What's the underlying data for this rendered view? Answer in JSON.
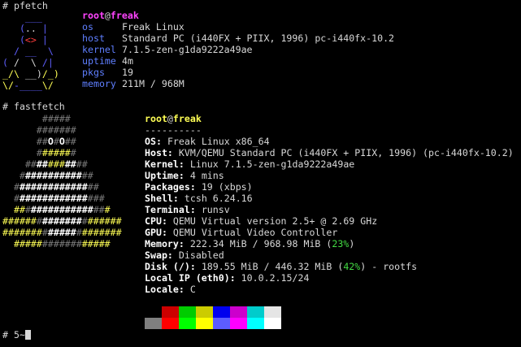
{
  "commands": {
    "pfetch": "# pfetch",
    "fastfetch": "# fastfetch",
    "prompt": "# 5~"
  },
  "pfetch": {
    "user": "root",
    "at": "@",
    "host": "freak",
    "rows": [
      {
        "key": "os",
        "value": "Freak Linux"
      },
      {
        "key": "host",
        "value": "Standard PC (i440FX + PIIX, 1996) pc-i440fx-10.2"
      },
      {
        "key": "kernel",
        "value": "7.1.5-zen-g1da9222a49ae"
      },
      {
        "key": "uptime",
        "value": "4m"
      },
      {
        "key": "pkgs",
        "value": "19"
      },
      {
        "key": "memory",
        "value": "211M / 968M"
      }
    ],
    "logo": [
      "    ___",
      "   (.. |",
      "   (<> |",
      "  / __  \\",
      " ( /  \\ /|",
      "_/\\ __)/_)",
      "\\/-____\\/"
    ]
  },
  "fastfetch": {
    "user": "root",
    "at": "@",
    "host": "freak",
    "separator": "----------",
    "rows": [
      {
        "key": "OS",
        "value": "Freak Linux x86_64"
      },
      {
        "key": "Host",
        "value": "KVM/QEMU Standard PC (i440FX + PIIX, 1996) (pc-i440fx-10.2)"
      },
      {
        "key": "Kernel",
        "value": "Linux 7.1.5-zen-g1da9222a49ae"
      },
      {
        "key": "Uptime",
        "value": "4 mins"
      },
      {
        "key": "Packages",
        "value": "19 (xbps)"
      },
      {
        "key": "Shell",
        "value": "tcsh 6.24.16"
      },
      {
        "key": "Terminal",
        "value": "runsv"
      },
      {
        "key": "CPU",
        "value": "QEMU Virtual version 2.5+ @ 2.69 GHz"
      },
      {
        "key": "GPU",
        "value": "QEMU Virtual Video Controller"
      }
    ],
    "memory": {
      "key": "Memory",
      "pre": "222.34 MiB / 968.98 MiB (",
      "pct": "23%",
      "post": ")"
    },
    "swap": {
      "key": "Swap",
      "value": "Disabled"
    },
    "disk": {
      "key": "Disk (/)",
      "pre": "189.55 MiB / 446.32 MiB (",
      "pct": "42%",
      "post": ") - rootfs"
    },
    "localip": {
      "key": "Local IP (eth0)",
      "value": "10.0.2.15/24"
    },
    "locale": {
      "key": "Locale",
      "value": "C"
    },
    "logo": [
      "      #####",
      "     #######",
      "     ##O#O##",
      "     #######",
      "   ###########",
      "  #############",
      " ###############",
      " ################",
      "#######################",
      "#######################",
      "  ################"
    ]
  },
  "palette": {
    "top": [
      "#000000",
      "#cc0000",
      "#00cc00",
      "#cccc00",
      "#0000ee",
      "#cc00cc",
      "#00cccc",
      "#e5e5e5"
    ],
    "bottom": [
      "#7f7f7f",
      "#ff0000",
      "#00ff00",
      "#ffff00",
      "#5c5cff",
      "#ff00ff",
      "#00ffff",
      "#ffffff"
    ]
  },
  "colors": {
    "user": "#ff44ff",
    "host": "#ffff55",
    "pfetch_logo": "#5f5fff",
    "pfetch_key": "#5f7fff",
    "percent": "#44dd44"
  }
}
